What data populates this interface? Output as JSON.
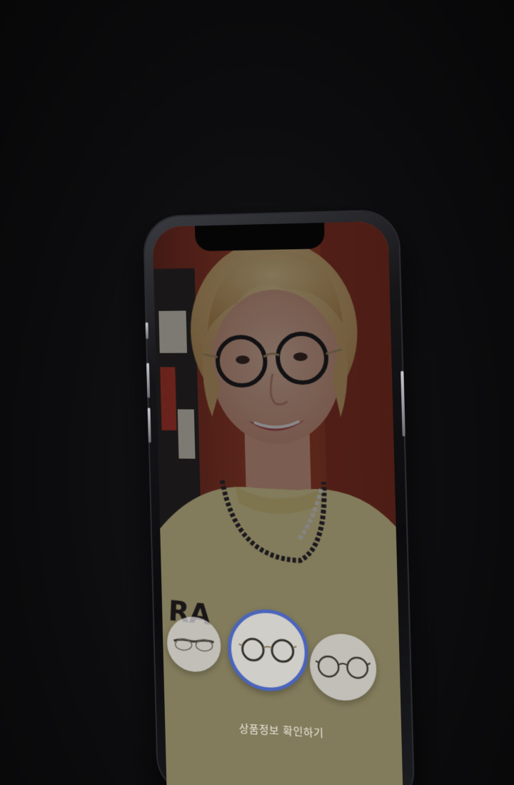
{
  "product_carousel": {
    "items": [
      {
        "icon": "browline-glasses-icon",
        "selected": false
      },
      {
        "icon": "round-glasses-icon",
        "selected": true
      },
      {
        "icon": "round-glasses-icon",
        "selected": false
      }
    ]
  },
  "cta": {
    "label": "상품정보 확인하기"
  },
  "colors": {
    "selected_ring": "#3b5fd6",
    "background": "#0d0d0f",
    "screen_tint": "#6b3b33"
  }
}
